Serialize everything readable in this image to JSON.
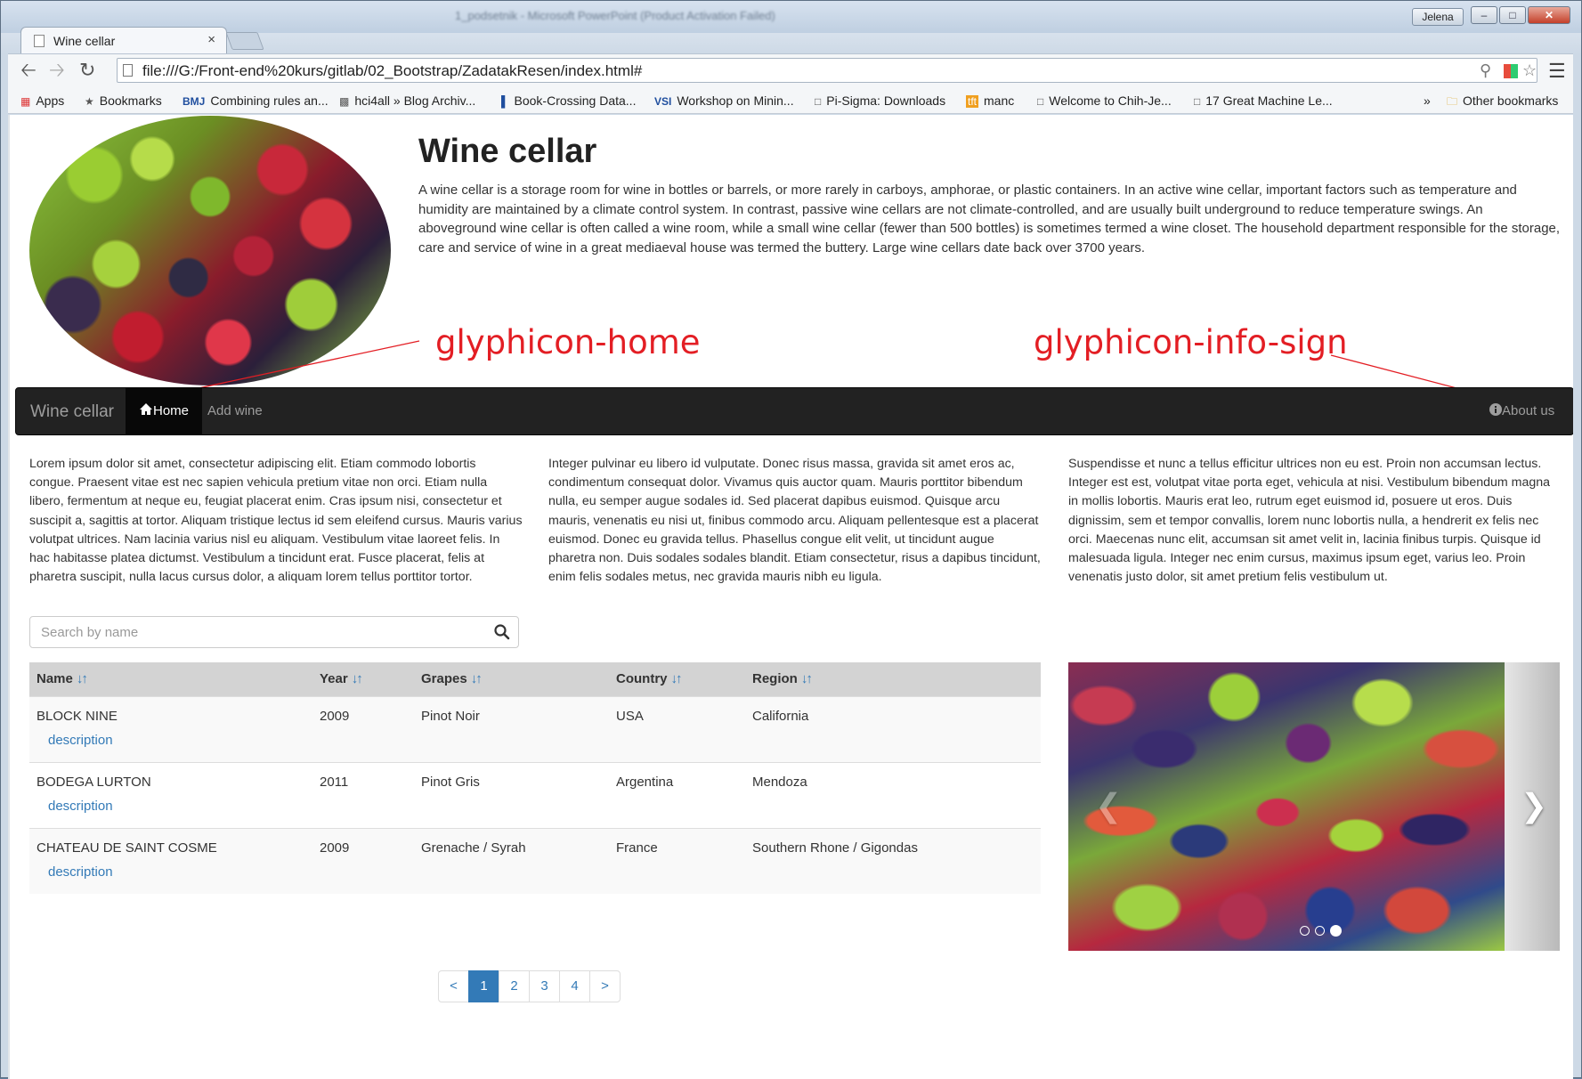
{
  "browser": {
    "window_title": "1_podsetnik - Microsoft PowerPoint (Product Activation Failed)",
    "user_badge": "Jelena",
    "tab_title": "Wine cellar",
    "tab_close": "×",
    "address": "file:///G:/Front-end%20kurs/gitlab/02_Bootstrap/ZadatakResen/index.html#",
    "bookmarks": [
      {
        "label": "Apps",
        "icon": "apps-grid-icon"
      },
      {
        "label": "Bookmarks",
        "icon": "star-icon"
      },
      {
        "label": "Combining rules an...",
        "icon": "bmj-icon"
      },
      {
        "label": "hci4all » Blog Archiv...",
        "icon": "hci-icon"
      },
      {
        "label": "Book-Crossing Data...",
        "icon": "chart-icon"
      },
      {
        "label": "Workshop on Minin...",
        "icon": "vsi-icon"
      },
      {
        "label": "Pi-Sigma: Downloads",
        "icon": "page-icon"
      },
      {
        "label": "manc",
        "icon": "tft-icon"
      },
      {
        "label": "Welcome to Chih-Je...",
        "icon": "page-icon"
      },
      {
        "label": "17 Great Machine Le...",
        "icon": "page-icon"
      }
    ],
    "bookmarks_overflow": "»",
    "other_bookmarks": "Other bookmarks"
  },
  "header": {
    "title": "Wine cellar",
    "intro": "A wine cellar is a storage room for wine in bottles or barrels, or more rarely in carboys, amphorae, or plastic containers. In an active wine cellar, important factors such as temperature and humidity are maintained by a climate control system. In contrast, passive wine cellars are not climate-controlled, and are usually built underground to reduce temperature swings. An aboveground wine cellar is often called a wine room, while a small wine cellar (fewer than 500 bottles) is sometimes termed a wine closet. The household department responsible for the storage, care and service of wine in a great mediaeval house was termed the buttery. Large wine cellars date back over 3700 years."
  },
  "annotations": {
    "home": "glyphicon-home",
    "info": "glyphicon-info-sign",
    "color": "#e31e24"
  },
  "navbar": {
    "brand": "Wine cellar",
    "links": [
      {
        "label": "Home",
        "active": true,
        "icon": "home-icon"
      },
      {
        "label": "Add wine",
        "active": false
      }
    ],
    "right_link": {
      "label": "About us",
      "icon": "info-sign-icon"
    }
  },
  "columns": [
    "Lorem ipsum dolor sit amet, consectetur adipiscing elit. Etiam commodo lobortis congue. Praesent vitae est nec sapien vehicula pretium vitae non orci. Etiam nulla libero, fermentum at neque eu, feugiat placerat enim. Cras ipsum nisi, consectetur et suscipit a, sagittis at tortor. Aliquam tristique lectus id sem eleifend cursus. Mauris varius volutpat ultrices. Nam lacinia varius nisl eu aliquam. Vestibulum vitae laoreet felis. In hac habitasse platea dictumst. Vestibulum a tincidunt erat. Fusce placerat, felis at pharetra suscipit, nulla lacus cursus dolor, a aliquam lorem tellus porttitor tortor.",
    "Integer pulvinar eu libero id vulputate. Donec risus massa, gravida sit amet eros ac, condimentum consequat dolor. Vivamus quis auctor quam. Mauris porttitor bibendum nulla, eu semper augue sodales id. Sed placerat dapibus euismod. Quisque arcu mauris, venenatis eu nisi ut, finibus commodo arcu. Aliquam pellentesque est a placerat euismod. Donec eu gravida tellus. Phasellus congue elit velit, ut tincidunt augue pharetra non. Duis sodales sodales blandit. Etiam consectetur, risus a dapibus tincidunt, enim felis sodales metus, nec gravida mauris nibh eu ligula.",
    "Suspendisse et nunc a tellus efficitur ultrices non eu est. Proin non accumsan lectus. Integer est est, volutpat vitae porta eget, vehicula at nisi. Vestibulum bibendum magna in mollis lobortis. Mauris erat leo, rutrum eget euismod id, posuere ut eros. Duis dignissim, sem et tempor convallis, lorem nunc lobortis nulla, a hendrerit ex felis nec orci. Maecenas nunc elit, accumsan sit amet velit in, lacinia finibus turpis. Quisque id malesuada ligula. Integer nec enim cursus, maximus ipsum eget, varius leo. Proin venenatis justo dolor, sit amet pretium felis vestibulum ut."
  ],
  "search": {
    "placeholder": "Search by name",
    "icon": "search-icon"
  },
  "table": {
    "headers": [
      "Name",
      "Year",
      "Grapes",
      "Country",
      "Region"
    ],
    "sort_icon": "sort-icon",
    "rows": [
      {
        "name": "BLOCK NINE",
        "year": "2009",
        "grapes": "Pinot Noir",
        "country": "USA",
        "region": "California",
        "link": "description"
      },
      {
        "name": "BODEGA LURTON",
        "year": "2011",
        "grapes": "Pinot Gris",
        "country": "Argentina",
        "region": "Mendoza",
        "link": "description"
      },
      {
        "name": "CHATEAU DE SAINT COSME",
        "year": "2009",
        "grapes": "Grenache / Syrah",
        "country": "France",
        "region": "Southern Rhone / Gigondas",
        "link": "description"
      }
    ]
  },
  "pagination": {
    "prev": "<",
    "pages": [
      "1",
      "2",
      "3",
      "4"
    ],
    "active": "1",
    "next": ">"
  },
  "carousel": {
    "prev_icon": "chevron-left-icon",
    "next_icon": "chevron-right-icon",
    "slide_count": 3,
    "active_slide": 3
  },
  "colors": {
    "navbar": "#222222",
    "link": "#337ab7",
    "table_header": "#d3d3d3"
  }
}
